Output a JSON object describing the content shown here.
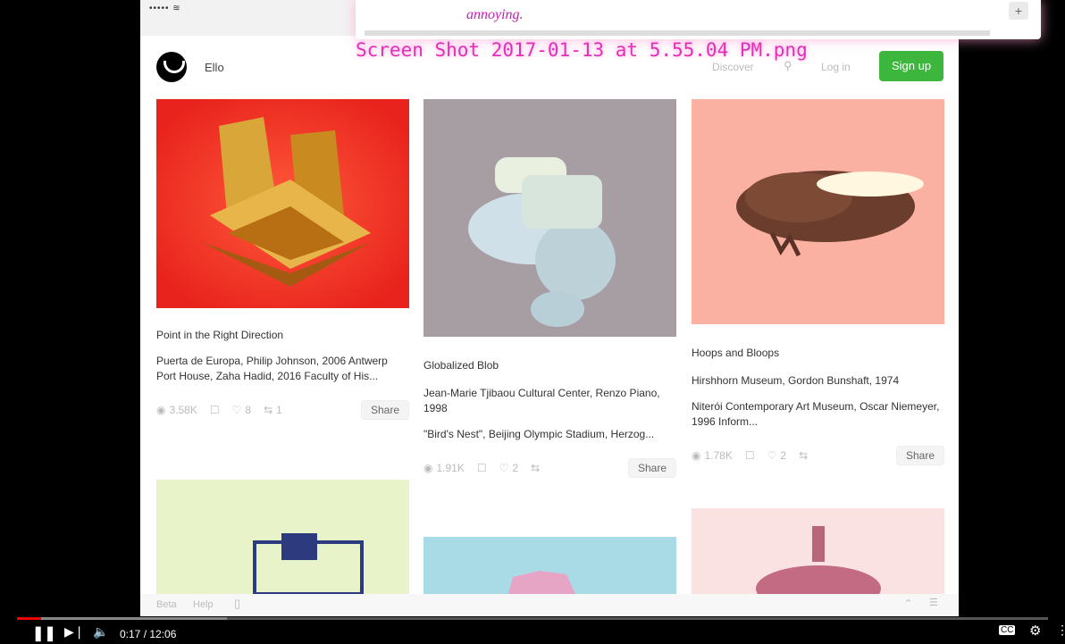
{
  "status_bar": {
    "carrier": "••••• ≋"
  },
  "header": {
    "brand": "Ello",
    "discover": "Discover",
    "login": "Log in",
    "signup": "Sign up"
  },
  "overlay": {
    "text": "annoying.",
    "filename": "Screen Shot 2017-01-13 at 5.55.04 PM.png"
  },
  "cards": [
    {
      "title": "Point in the Right Direction",
      "description": "Puerta de Europa, Philip Johnson, 2006 Antwerp Port House, Zaha Hadid, 2016 Faculty of His...",
      "views": "3.58K",
      "likes": "8",
      "reposts": "1",
      "share": "Share"
    },
    {
      "title": "Globalized Blob",
      "description1": "Jean-Marie Tjibaou Cultural Center, Renzo Piano, 1998",
      "description2": "\"Bird's Nest\", Beijing Olympic Stadium, Herzog...",
      "views": "1.91K",
      "likes": "2",
      "share": "Share"
    },
    {
      "title": "Hoops and Bloops",
      "description1": "Hirshhorn Museum, Gordon Bunshaft, 1974",
      "description2": "Niterói Contemporary Art Museum, Oscar Niemeyer, 1996 Inform...",
      "views": "1.78K",
      "likes": "2",
      "share": "Share"
    }
  ],
  "footer": {
    "beta": "Beta",
    "help": "Help"
  },
  "player": {
    "time": "0:17 / 12:06",
    "progress_fraction": 0.0236
  },
  "colors": {
    "signup": "#3db63d",
    "overlay_text": "#c21db3",
    "filename": "#e22fb9",
    "progress_played": "#e00000"
  }
}
